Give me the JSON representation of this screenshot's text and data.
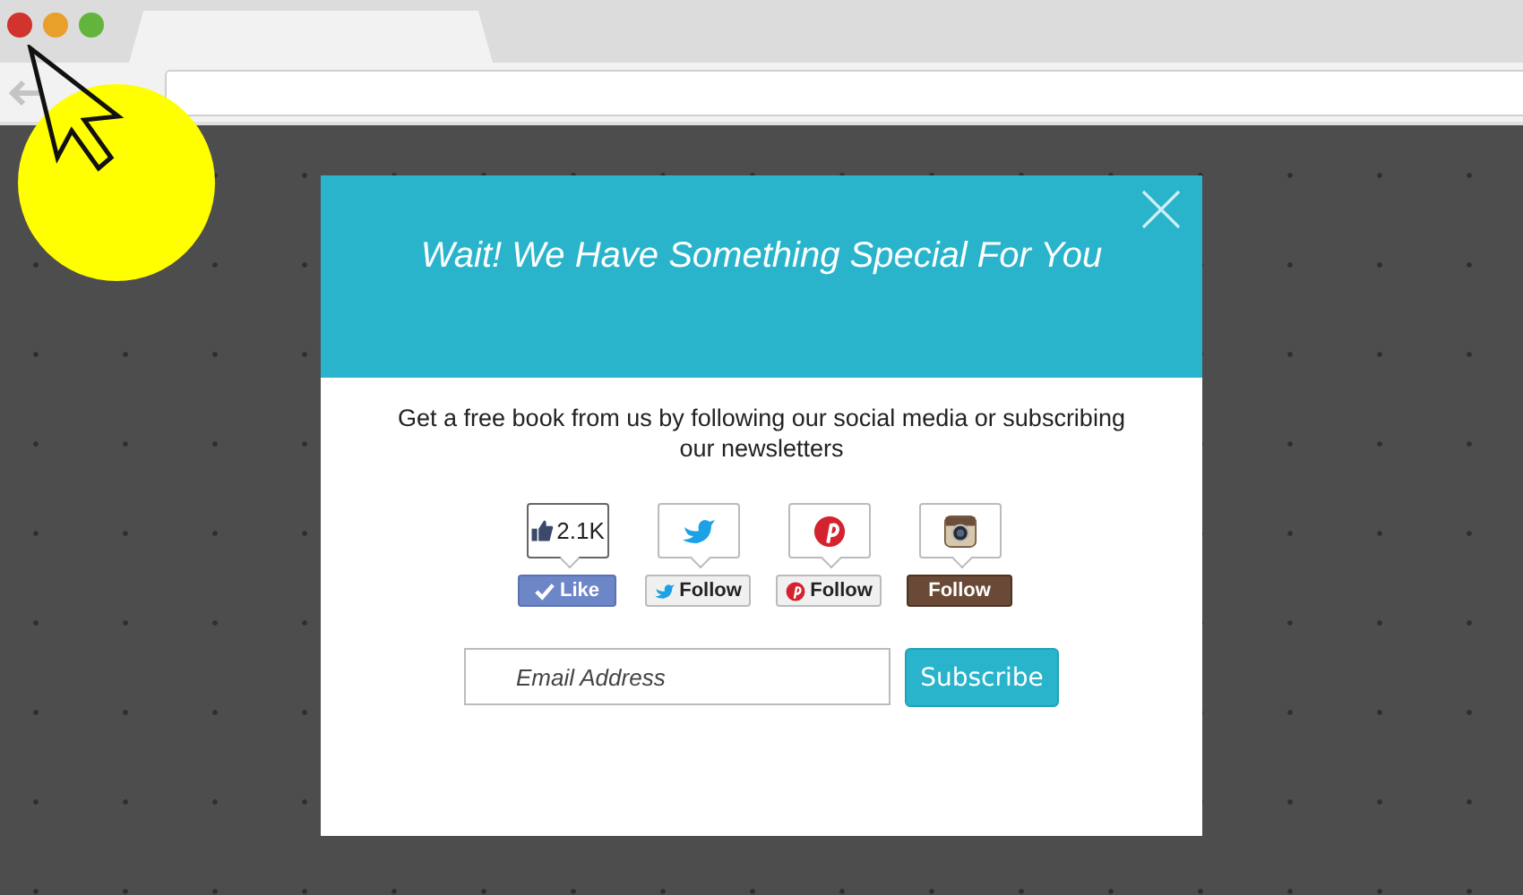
{
  "window_controls": [
    {
      "color": "#d0342c"
    },
    {
      "color": "#e8a02a"
    },
    {
      "color": "#62b43c"
    }
  ],
  "popup": {
    "title": "Wait! We Have Something Special For You",
    "message": "Get a free book from us by following our social media or subscribing our newsletters",
    "social": [
      {
        "kind": "facebook",
        "count": "2.1K",
        "button": "Like"
      },
      {
        "kind": "twitter",
        "button": "Follow"
      },
      {
        "kind": "pinterest",
        "button": "Follow"
      },
      {
        "kind": "instagram",
        "button": "Follow"
      }
    ],
    "email": {
      "placeholder": "Email Address"
    },
    "subscribe": "Subscribe"
  }
}
